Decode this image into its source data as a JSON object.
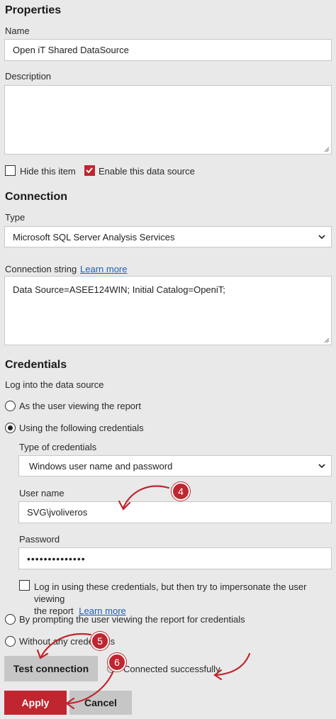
{
  "properties": {
    "heading": "Properties",
    "name_label": "Name",
    "name_value": "Open iT Shared DataSource",
    "description_label": "Description",
    "description_value": "",
    "hide_label": "Hide this item",
    "hide_checked": false,
    "enable_label": "Enable this data source",
    "enable_checked": true
  },
  "connection": {
    "heading": "Connection",
    "type_label": "Type",
    "type_value": "Microsoft SQL Server Analysis Services",
    "conn_string_label": "Connection string",
    "learn_more": "Learn more",
    "conn_string_value": "Data Source=ASEE124WIN; Initial Catalog=OpeniT;"
  },
  "credentials": {
    "heading": "Credentials",
    "log_into_label": "Log into the data source",
    "option_viewer": "As the user viewing the report",
    "option_following": "Using the following credentials",
    "type_label": "Type of credentials",
    "type_value": "Windows user name and password",
    "username_label": "User name",
    "username_value": "SVG\\jvoliveros",
    "password_label": "Password",
    "password_mask": "••••••••••••••",
    "impersonate_label_line1": "Log in using these credentials, but then try to impersonate the user viewing",
    "impersonate_label_line2": "the report",
    "impersonate_learn_more": "Learn more",
    "option_prompt": "By prompting the user viewing the report for credentials",
    "option_without": "Without any credentials"
  },
  "actions": {
    "test_button": "Test connection",
    "status_text": "Connected successfully",
    "apply_button": "Apply",
    "cancel_button": "Cancel"
  },
  "annotations": {
    "badge_4": "4",
    "badge_5": "5",
    "badge_6": "6"
  },
  "colors": {
    "accent": "#c0262f",
    "link": "#1e5fb4",
    "background": "#e9e9e9"
  }
}
